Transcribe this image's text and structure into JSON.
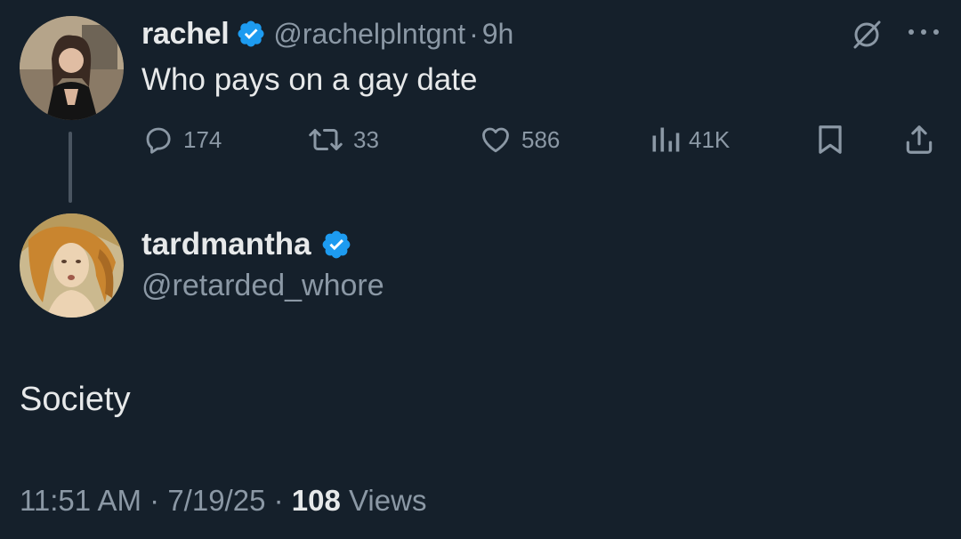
{
  "parent_tweet": {
    "display_name": "rachel",
    "handle": "@rachelplntgnt",
    "separator": "·",
    "time": "9h",
    "text": "Who pays on a gay date",
    "actions": {
      "replies": "174",
      "reposts": "33",
      "likes": "586",
      "views": "41K"
    }
  },
  "reply_tweet": {
    "display_name": "tardmantha",
    "handle": "@retarded_whore",
    "text": "Society",
    "time": "11:51 AM",
    "date": "7/19/25",
    "separator": "·",
    "views_count": "108",
    "views_label": "Views"
  },
  "icons": {
    "verified": "verified-badge-icon",
    "grok": "grok-icon",
    "more": "more-dots-icon",
    "reply": "reply-icon",
    "repost": "repost-icon",
    "like": "heart-icon",
    "views": "analytics-icon",
    "bookmark": "bookmark-icon",
    "share": "share-icon"
  },
  "colors": {
    "background": "#15202b",
    "text_primary": "#e7e9ea",
    "text_secondary": "#8b98a5",
    "verified_blue": "#1d9bf0"
  }
}
